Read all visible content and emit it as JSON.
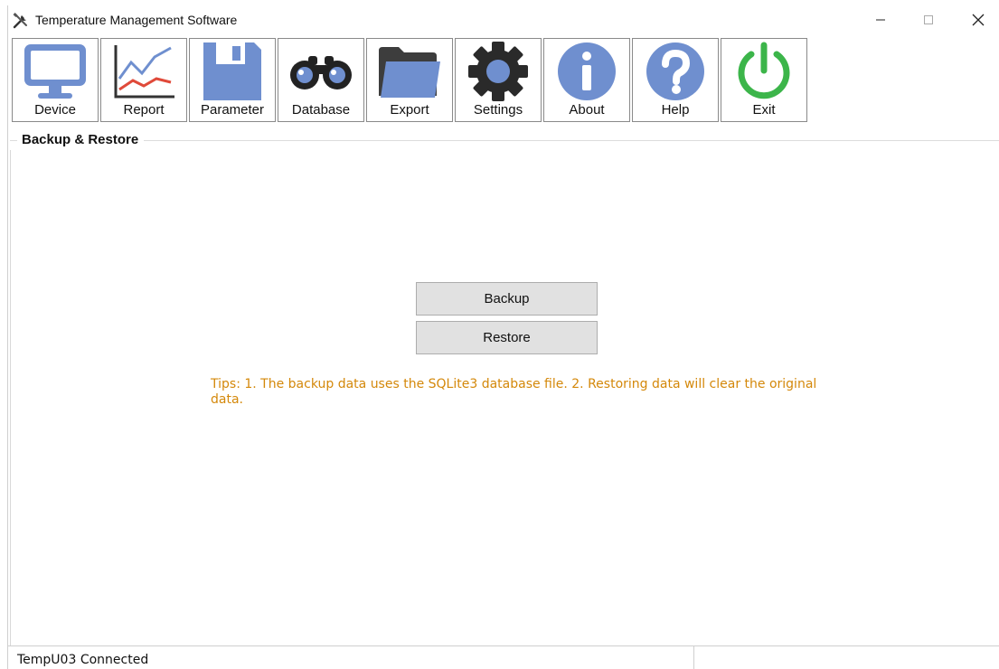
{
  "window": {
    "title": "Temperature Management Software",
    "controls": {
      "minimize": "–",
      "maximize": "☐",
      "close": "✕"
    }
  },
  "toolbar": {
    "items": [
      {
        "label": "Device",
        "icon": "monitor-icon"
      },
      {
        "label": "Report",
        "icon": "line-chart-icon"
      },
      {
        "label": "Parameter",
        "icon": "floppy-disk-icon"
      },
      {
        "label": "Database",
        "icon": "binoculars-icon"
      },
      {
        "label": "Export",
        "icon": "folder-icon"
      },
      {
        "label": "Settings",
        "icon": "gear-icon"
      },
      {
        "label": "About",
        "icon": "info-icon"
      },
      {
        "label": "Help",
        "icon": "question-icon"
      },
      {
        "label": "Exit",
        "icon": "power-icon"
      }
    ]
  },
  "panel": {
    "title": "Backup & Restore",
    "backup_label": "Backup",
    "restore_label": "Restore",
    "tips": "Tips: 1. The backup data uses the SQLite3 database file. 2. Restoring data will clear the original data."
  },
  "statusbar": {
    "text": "TempU03 Connected"
  },
  "colors": {
    "icon_blue": "#6f8fcf",
    "chart_red": "#e04a3a",
    "power_green": "#3cb54a",
    "tips_orange": "#d4880a"
  }
}
